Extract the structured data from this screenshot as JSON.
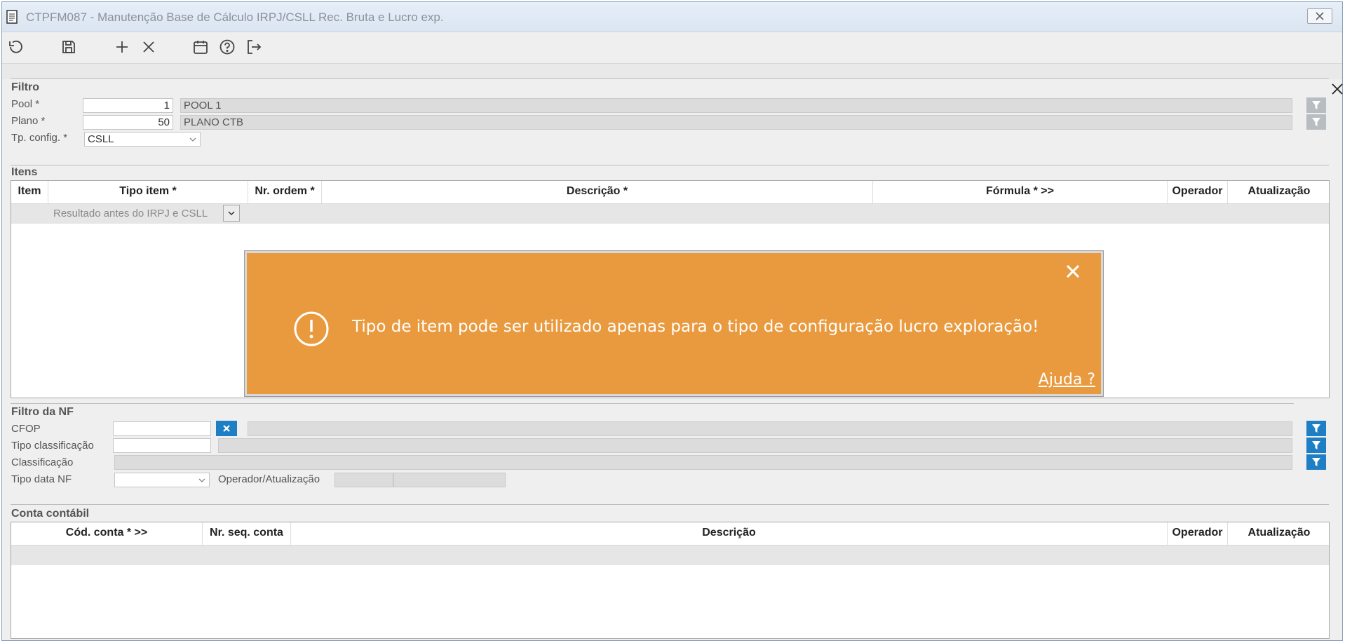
{
  "window": {
    "title": "CTPFM087 - Manutenção Base de Cálculo IRPJ/CSLL Rec. Bruta e Lucro exp."
  },
  "toolbar": {
    "icons": [
      "undo-icon",
      "save-icon",
      "add-icon",
      "delete-icon",
      "calendar-icon",
      "help-icon",
      "exit-icon"
    ]
  },
  "filtro": {
    "title": "Filtro",
    "pool_label": "Pool *",
    "pool_value": "1",
    "pool_desc": "POOL 1",
    "plano_label": "Plano *",
    "plano_value": "50",
    "plano_desc": "PLANO CTB",
    "tpconfig_label": "Tp. config. *",
    "tpconfig_value": "CSLL"
  },
  "itens": {
    "title": "Itens",
    "columns": [
      "Item",
      "Tipo item *",
      "Nr. ordem *",
      "Descrição *",
      "Fórmula * >>",
      "Operador",
      "Atualização"
    ],
    "row_tipo": "Resultado antes do IRPJ e CSLL"
  },
  "toast": {
    "message": "Tipo de item pode ser utilizado apenas para o tipo de configuração lucro exploração!",
    "help": "Ajuda ?",
    "color": "#ea9a3e"
  },
  "filtro_nf": {
    "title": "Filtro da NF",
    "cfop_label": "CFOP",
    "tipo_class_label": "Tipo classificação",
    "class_label": "Classificação",
    "tipo_data_label": "Tipo data NF",
    "operador_label": "Operador/Atualização"
  },
  "conta": {
    "title": "Conta contábil",
    "columns": [
      "Cód. conta * >>",
      "Nr. seq. conta",
      "Descrição",
      "Operador",
      "Atualização"
    ]
  },
  "colors": {
    "accent_blue": "#1e7fc5",
    "filter_gray": "#b8bdc2"
  }
}
